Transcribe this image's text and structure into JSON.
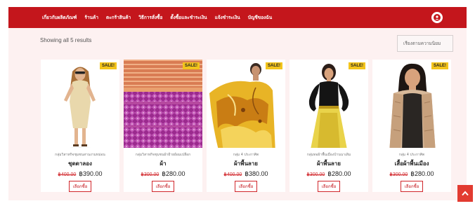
{
  "nav": {
    "items": [
      "เกี่ยวกับผลิตภัณฑ์",
      "ร้านค้า",
      "ตะกร้าสินค้า",
      "วิธีการสั่งซื้อ",
      "ตั้งซื้อและชำระเงิน",
      "แจ้งชำระเงิน",
      "บัญชีของฉัน"
    ]
  },
  "shop": {
    "result_count": "Showing all 5 results",
    "sort_label": "เรียงตามความนิยม",
    "buy_label": "เลือกซื้อ",
    "sale_label": "SALE!"
  },
  "products": [
    {
      "category": "กลุ่มวิสาหกิจชุมชนสานงามหม่อน",
      "name": "ชุดดาลอง",
      "old_price": "฿400.00",
      "new_price": "฿390.00"
    },
    {
      "category": "กลุ่มวิสาหกิจชุมชนผ้าฝ้ายย้อมเปลือก",
      "name": "ผ้า",
      "old_price": "฿300.00",
      "new_price": "฿280.00"
    },
    {
      "category": "กลุ่ม 4 ประกาศิต",
      "name": "ผ้าพื้นลาย",
      "old_price": "฿400.00",
      "new_price": "฿380.00"
    },
    {
      "category": "กลุ่มทอผ้าพื้นเมืองบ้านนาเดิม",
      "name": "ผ้าพื้นลาย",
      "old_price": "฿300.00",
      "new_price": "฿280.00"
    },
    {
      "category": "กลุ่ม 4 ประกาศิต",
      "name": "เสื้อผ้าพื้นเมือง",
      "old_price": "฿300.00",
      "new_price": "฿280.00"
    }
  ],
  "colors": {
    "brand_red": "#c4161c",
    "sale_yellow": "#f3c41c",
    "page_bg": "#fdf1f1"
  },
  "icons": {
    "account": "user-circle-icon",
    "scroll_top": "chevron-up-icon"
  }
}
